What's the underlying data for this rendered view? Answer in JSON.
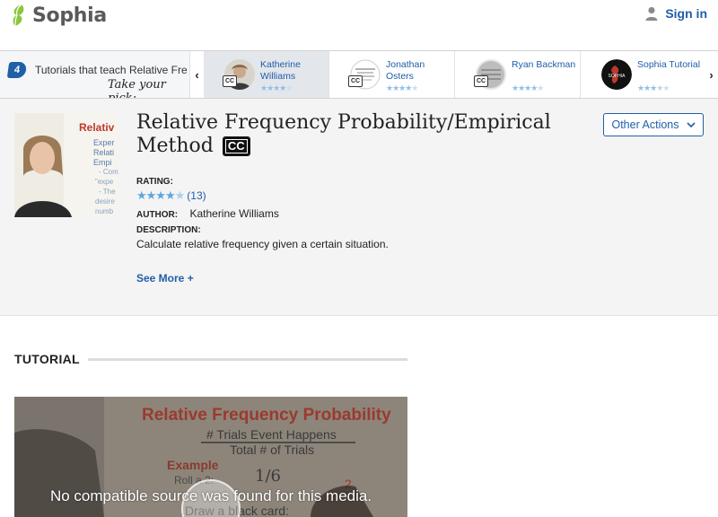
{
  "header": {
    "logo_text": "Sophia",
    "signin_label": "Sign in"
  },
  "strip": {
    "count": "4",
    "intro_text": "Tutorials that teach Relative Fre",
    "take_pick": "Take your pick:",
    "tutors": [
      {
        "name": "Katherine Williams",
        "cc": "CC",
        "rating": 4,
        "active": true
      },
      {
        "name": "Jonathan Osters",
        "cc": "CC",
        "rating": 4,
        "active": false
      },
      {
        "name": "Ryan Backman",
        "cc": "CC",
        "rating": 4,
        "active": false
      },
      {
        "name": "Sophia Tutorial",
        "cc": "",
        "rating": 3.5,
        "active": false
      }
    ]
  },
  "info": {
    "title": "Relative Frequency Probability/Empirical Method",
    "cc_badge": "CC",
    "other_actions_label": "Other Actions",
    "rating_label": "RATING:",
    "rating_stars": 4.5,
    "rating_count": "(13)",
    "author_label": "AUTHOR:",
    "author_name": "Katherine Williams",
    "description_label": "DESCRIPTION:",
    "description": "Calculate relative frequency given a certain situation.",
    "see_more_label": "See More +"
  },
  "tutorial": {
    "section_title": "TUTORIAL",
    "player_message": "No compatible source was found for this media."
  },
  "colors": {
    "brand_blue": "#1f5fa8",
    "logo_green": "#8cc63f",
    "star_blue": "#5aa7e0"
  }
}
